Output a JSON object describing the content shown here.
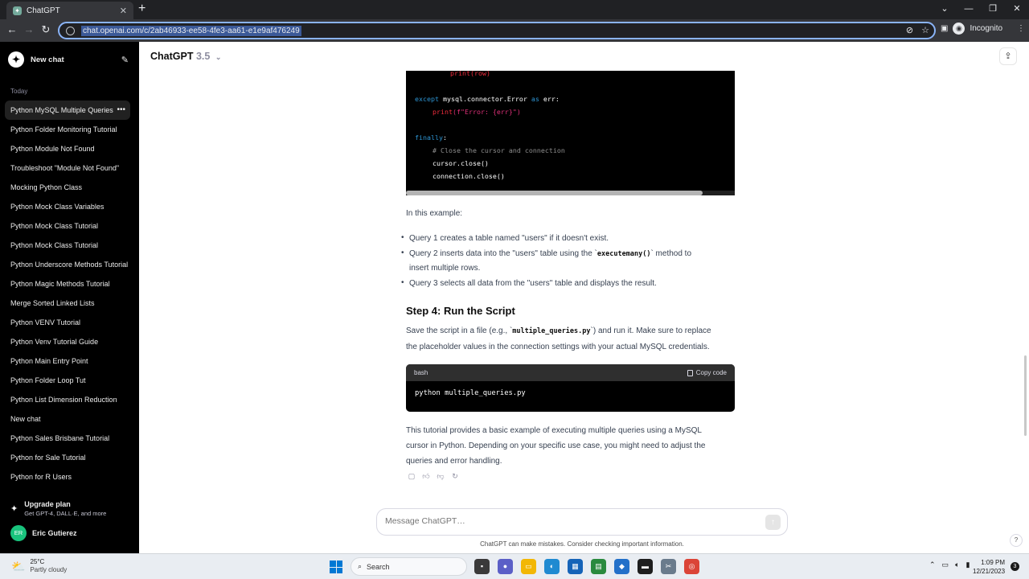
{
  "browser": {
    "tab_title": "ChatGPT",
    "url": "chat.openai.com/c/2ab46933-ee58-4fe3-aa61-e1e9af476249",
    "profile_label": "Incognito"
  },
  "sidebar": {
    "new_chat_label": "New chat",
    "section_label": "Today",
    "items": [
      {
        "label": "Python MySQL Multiple Queries"
      },
      {
        "label": "Python Folder Monitoring Tutorial"
      },
      {
        "label": "Python Module Not Found"
      },
      {
        "label": "Troubleshoot \"Module Not Found\""
      },
      {
        "label": "Mocking Python Class"
      },
      {
        "label": "Python Mock Class Variables"
      },
      {
        "label": "Python Mock Class Tutorial"
      },
      {
        "label": "Python Mock Class Tutorial"
      },
      {
        "label": "Python Underscore Methods Tutorial"
      },
      {
        "label": "Python Magic Methods Tutorial"
      },
      {
        "label": "Merge Sorted Linked Lists"
      },
      {
        "label": "Python VENV Tutorial"
      },
      {
        "label": "Python Venv Tutorial Guide"
      },
      {
        "label": "Python Main Entry Point"
      },
      {
        "label": "Python Folder Loop Tut"
      },
      {
        "label": "Python List Dimension Reduction"
      },
      {
        "label": "New chat"
      },
      {
        "label": "Python Sales Brisbane Tutorial"
      },
      {
        "label": "Python for Sale Tutorial"
      },
      {
        "label": "Python for R Users"
      }
    ],
    "upgrade_title": "Upgrade plan",
    "upgrade_subtitle": "Get GPT-4, DALL·E, and more",
    "user_initials": "ER",
    "user_name": "Eric Gutierez"
  },
  "header": {
    "model_name": "ChatGPT",
    "model_version": "3.5"
  },
  "code_top": {
    "l1": "print(row)",
    "l2_kw": "except",
    "l2_rest": " mysql.connector.Error ",
    "l2_as": "as",
    "l2_end": " err:",
    "l3_fn": "print",
    "l3_str": "(f\"Error: {err}\")",
    "l4_kw": "finally",
    "l4_end": ":",
    "l5": "# Close the cursor and connection",
    "l6": "cursor.close()",
    "l7": "connection.close()"
  },
  "content": {
    "example_intro": "In this example:",
    "b1": "Query 1 creates a table named \"users\" if it doesn't exist.",
    "b2_pre": "Query 2 inserts data into the \"users\" table using the `",
    "b2_code": "executemany()",
    "b2_post": "` method to",
    "b2_line2": "insert multiple rows.",
    "b3": "Query 3 selects all data from the \"users\" table and displays the result.",
    "step4_heading": "Step 4: Run the Script",
    "save_pre": "Save the script in a file (e.g., `",
    "save_code": "multiple_queries.py",
    "save_post": "`) and run it. Make sure to replace",
    "save_line2": "the placeholder values in the connection settings with your actual MySQL credentials.",
    "bash_lang": "bash",
    "copy_code": "Copy code",
    "bash_cmd": "python multiple_queries.py",
    "outro_l1": "This tutorial provides a basic example of executing multiple queries using a MySQL",
    "outro_l2": "cursor in Python. Depending on your specific use case, you might need to adjust the",
    "outro_l3": "queries and error handling."
  },
  "composer": {
    "placeholder": "Message ChatGPT…",
    "disclaimer": "ChatGPT can make mistakes. Consider checking important information."
  },
  "taskbar": {
    "temperature": "25°C",
    "condition": "Partly cloudy",
    "search_label": "Search",
    "time": "1:09 PM",
    "date": "12/21/2023",
    "notification_count": "3"
  }
}
